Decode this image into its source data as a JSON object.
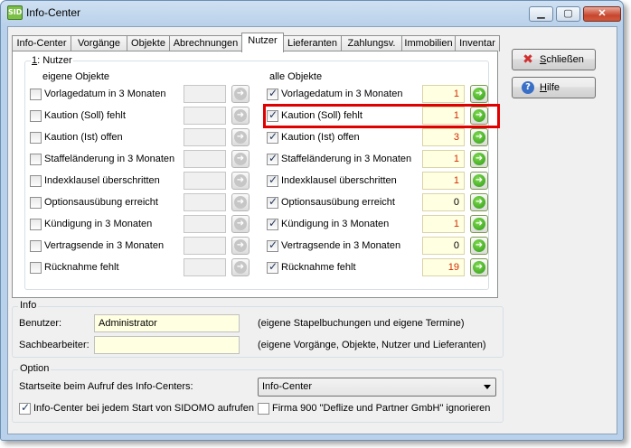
{
  "window": {
    "title": "Info-Center",
    "app_icon_text": "SID"
  },
  "tabs": [
    "Info-Center",
    "Vorgänge",
    "Objekte",
    "Abrechnungen",
    "Nutzer",
    "Lieferanten",
    "Zahlungsv.",
    "Immobilien",
    "Inventar"
  ],
  "active_tab": "Nutzer",
  "panel": {
    "group_prefix": "1",
    "group_title": ": Nutzer",
    "own_header": "eigene Objekte",
    "all_header": "alle Objekte",
    "rows": [
      {
        "label": "Vorlagedatum in 3 Monaten",
        "all_checked": true,
        "all_value": "1",
        "value_red": true
      },
      {
        "label": "Kaution (Soll) fehlt",
        "all_checked": true,
        "all_value": "1",
        "value_red": true
      },
      {
        "label": "Kaution (Ist) offen",
        "all_checked": true,
        "all_value": "3",
        "value_red": true
      },
      {
        "label": "Staffeländerung in 3 Monaten",
        "all_checked": true,
        "all_value": "1",
        "value_red": true
      },
      {
        "label": "Indexklausel überschritten",
        "all_checked": true,
        "all_value": "1",
        "value_red": true
      },
      {
        "label": "Optionsausübung erreicht",
        "all_checked": true,
        "all_value": "0",
        "value_red": false
      },
      {
        "label": "Kündigung in 3 Monaten",
        "all_checked": true,
        "all_value": "1",
        "value_red": true
      },
      {
        "label": "Vertragsende in 3 Monaten",
        "all_checked": true,
        "all_value": "0",
        "value_red": false
      },
      {
        "label": "Rücknahme fehlt",
        "all_checked": true,
        "all_value": "19",
        "value_red": true
      }
    ]
  },
  "buttons": {
    "close": "Schließen",
    "close_mnemonic": "S",
    "help": "Hilfe",
    "help_mnemonic": "H"
  },
  "info": {
    "title": "Info",
    "user_label": "Benutzer:",
    "user_value": "Administrator",
    "user_hint": "(eigene Stapelbuchungen und eigene Termine)",
    "clerk_label": "Sachbearbeiter:",
    "clerk_value": "",
    "clerk_hint": "(eigene Vorgänge, Objekte, Nutzer und Lieferanten)"
  },
  "option": {
    "title": "Option",
    "start_label": "Startseite beim Aufruf des Info-Centers:",
    "start_value": "Info-Center",
    "open_on_start": "Info-Center bei jedem Start von SIDOMO aufrufen",
    "open_on_start_checked": true,
    "ignore_firm": "Firma 900 \"Deflize und Partner GmbH\" ignorieren",
    "ignore_firm_checked": false
  },
  "colors": {
    "highlight": "#e00000",
    "value_red": "#d22b00",
    "active_field": "#ffffe1",
    "go_green": "#2f9a16"
  }
}
